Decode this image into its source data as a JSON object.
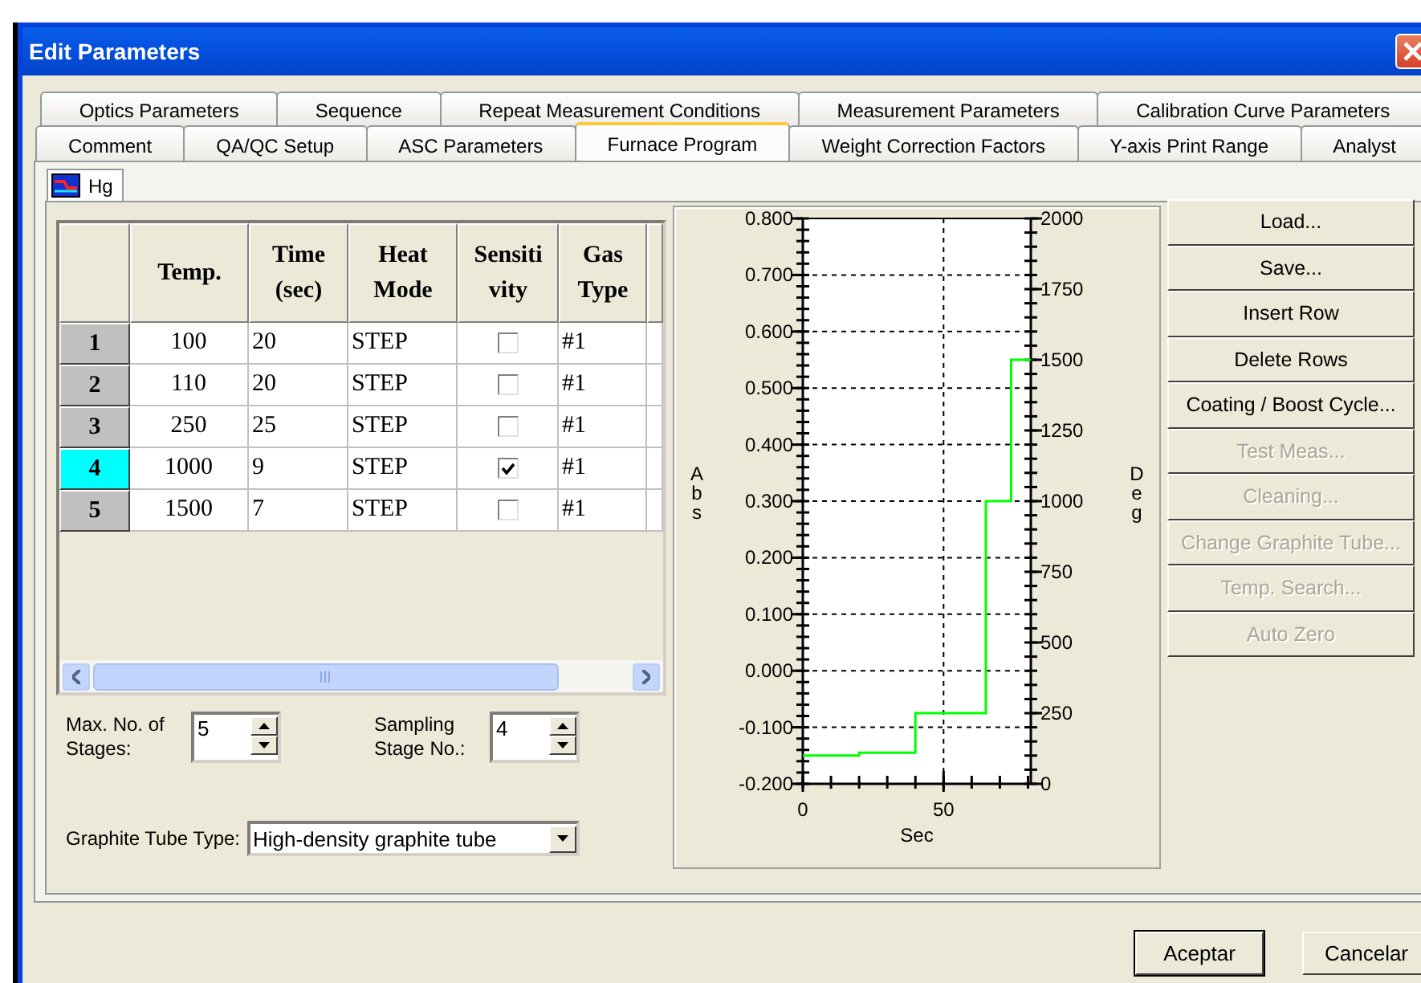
{
  "window": {
    "title": "Edit Parameters"
  },
  "tab_rows": [
    {
      "tabs": [
        {
          "label": "Optics Parameters",
          "selected": false
        },
        {
          "label": "Sequence",
          "selected": false
        },
        {
          "label": "Repeat Measurement Conditions",
          "selected": false
        },
        {
          "label": "Measurement Parameters",
          "selected": false
        },
        {
          "label": "Calibration Curve Parameters",
          "selected": false
        }
      ]
    },
    {
      "tabs": [
        {
          "label": "Comment",
          "selected": false
        },
        {
          "label": "QA/QC Setup",
          "selected": false
        },
        {
          "label": "ASC Parameters",
          "selected": false
        },
        {
          "label": "Furnace Program",
          "selected": true
        },
        {
          "label": "Weight Correction Factors",
          "selected": false
        },
        {
          "label": "Y-axis Print Range",
          "selected": false
        },
        {
          "label": "Analyst",
          "selected": false
        }
      ]
    }
  ],
  "element_tab": {
    "label": "Hg"
  },
  "table": {
    "columns": [
      {
        "lines": [
          "Temp."
        ]
      },
      {
        "lines": [
          "Time",
          "(sec)"
        ]
      },
      {
        "lines": [
          "Heat",
          "Mode"
        ]
      },
      {
        "lines": [
          "Sensiti",
          "vity"
        ]
      },
      {
        "lines": [
          "Gas",
          "Type"
        ]
      }
    ],
    "rows": [
      {
        "number": "1",
        "selected": false,
        "temp": "100",
        "time": "20",
        "heat_mode": "STEP",
        "sensitivity": false,
        "gas_type": "#1"
      },
      {
        "number": "2",
        "selected": false,
        "temp": "110",
        "time": "20",
        "heat_mode": "STEP",
        "sensitivity": false,
        "gas_type": "#1"
      },
      {
        "number": "3",
        "selected": false,
        "temp": "250",
        "time": "25",
        "heat_mode": "STEP",
        "sensitivity": false,
        "gas_type": "#1"
      },
      {
        "number": "4",
        "selected": true,
        "temp": "1000",
        "time": "9",
        "heat_mode": "STEP",
        "sensitivity": true,
        "gas_type": "#1"
      },
      {
        "number": "5",
        "selected": false,
        "temp": "1500",
        "time": "7",
        "heat_mode": "STEP",
        "sensitivity": false,
        "gas_type": "#1"
      }
    ]
  },
  "max_stages": {
    "label": "Max. No. of Stages:",
    "value": "5"
  },
  "sampling_stage": {
    "label": "Sampling Stage No.:",
    "value": "4"
  },
  "graphite_tube": {
    "label": "Graphite Tube Type:",
    "value": "High-density graphite tube"
  },
  "chart": {
    "chart_data": {
      "type": "line",
      "xlabel": "Sec",
      "ylabel": "Deg",
      "y2label": "Abs",
      "x": [
        0,
        20,
        20,
        40,
        40,
        65,
        65,
        74,
        74,
        81
      ],
      "series": [
        {
          "color": "#00ff00",
          "values": [
            100,
            100,
            110,
            110,
            250,
            250,
            1000,
            1000,
            1500,
            1500
          ]
        }
      ],
      "grid": true,
      "xlim": [
        0,
        81
      ],
      "ylim": [
        0,
        2000
      ],
      "y2lim": [
        -0.2,
        0.8
      ],
      "xticks": [
        0,
        50
      ],
      "y2ticks": [
        {
          "value": -0.2,
          "label": "-0.200"
        },
        {
          "value": -0.1,
          "label": "-0.100"
        },
        {
          "value": 0,
          "label": "0.000"
        },
        {
          "value": 0.1,
          "label": "0.100"
        },
        {
          "value": 0.2,
          "label": "0.200"
        },
        {
          "value": 0.3,
          "label": "0.300"
        },
        {
          "value": 0.4,
          "label": "0.400"
        },
        {
          "value": 0.5,
          "label": "0.500"
        },
        {
          "value": 0.6,
          "label": "0.600"
        },
        {
          "value": 0.7,
          "label": "0.700"
        },
        {
          "value": 0.8,
          "label": "0.800"
        }
      ],
      "yticks": [
        0,
        250,
        500,
        750,
        1000,
        1250,
        1500,
        1750,
        2000
      ]
    }
  },
  "side_buttons": [
    {
      "label": "Load...",
      "disabled": false
    },
    {
      "label": "Save...",
      "disabled": false
    },
    {
      "label": "Insert Row",
      "disabled": false
    },
    {
      "label": "Delete Rows",
      "disabled": false
    },
    {
      "label": "Coating / Boost Cycle...",
      "disabled": false
    },
    {
      "label": "Test Meas...",
      "disabled": true
    },
    {
      "label": "Cleaning...",
      "disabled": true
    },
    {
      "label": "Change Graphite Tube...",
      "disabled": true
    },
    {
      "label": "Temp. Search...",
      "disabled": true
    },
    {
      "label": "Auto Zero",
      "disabled": true
    }
  ],
  "dialog_buttons": [
    {
      "label": "Aceptar",
      "default": true
    },
    {
      "label": "Cancelar",
      "default": false
    }
  ]
}
